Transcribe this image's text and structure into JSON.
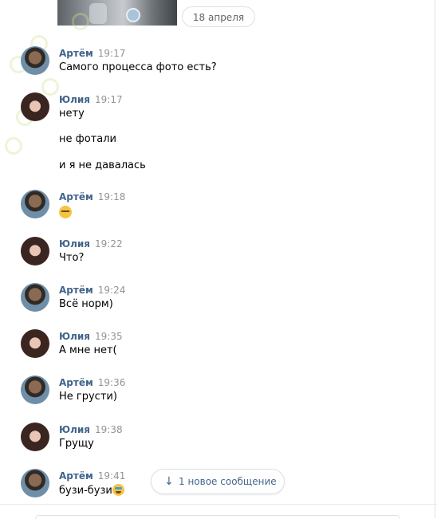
{
  "date_divider": "18 апреля",
  "messages": [
    {
      "author": "Артём",
      "time": "19:17",
      "text": "Самого процесса фото есть?"
    },
    {
      "author": "Юлия",
      "time": "19:17",
      "lines": [
        "нету",
        "не фотали",
        "и я не давалась"
      ]
    },
    {
      "author": "Артём",
      "time": "19:18",
      "emoji": "relieved-face"
    },
    {
      "author": "Юлия",
      "time": "19:22",
      "text": "Что?"
    },
    {
      "author": "Артём",
      "time": "19:24",
      "text": "Всё норм)"
    },
    {
      "author": "Юлия",
      "time": "19:35",
      "text": "А мне нет("
    },
    {
      "author": "Артём",
      "time": "19:36",
      "text": "Не грусти)"
    },
    {
      "author": "Юлия",
      "time": "19:38",
      "text": "Грущу"
    },
    {
      "author": "Артём",
      "time": "19:41",
      "text": "бузи-бузи",
      "emoji": "tears-of-joy"
    }
  ],
  "new_messages_button": "1 новое сообщение",
  "icons": {
    "arrow": "arrow-down-icon"
  },
  "colors": {
    "author": "#42648b",
    "time": "#939393",
    "accent": "#45678f",
    "border": "#dce1e6"
  }
}
